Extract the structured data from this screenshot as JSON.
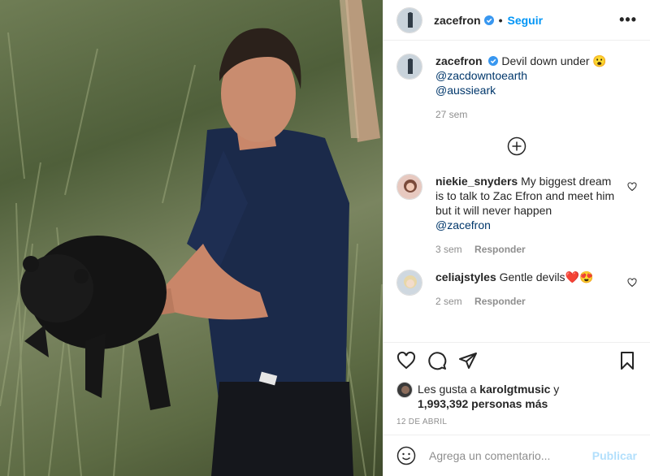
{
  "post": {
    "image_alt": "Man holding a Tasmanian devil in tall grass",
    "colors": {
      "accent": "#0095f6",
      "verified": "#3897f0",
      "muted": "#8e8e8e",
      "publish_disabled": "#b2dffc"
    }
  },
  "header": {
    "username": "zacefron",
    "separator": "•",
    "follow_label": "Seguir",
    "more_label": "•••"
  },
  "caption": {
    "username": "zacefron",
    "text": "Devil down under 😮",
    "mention1": "@zacdowntoearth",
    "mention2": "@aussieark",
    "time": "27 sem"
  },
  "comments": [
    {
      "username": "niekie_snyders",
      "text": "My biggest dream is to talk to Zac Efron and meet him but it will never happen",
      "mention": "@zacefron",
      "time": "3 sem",
      "reply_label": "Responder"
    },
    {
      "username": "celiajstyles",
      "text": "Gentle devils❤️😍",
      "time": "2 sem",
      "reply_label": "Responder"
    }
  ],
  "likes": {
    "prefix": "Les gusta a ",
    "user": "karolgtmusic",
    "suffix": " y",
    "count_text": "1,993,392 personas más"
  },
  "date": "12 DE ABRIL",
  "add_comment": {
    "placeholder": "Agrega un comentario...",
    "publish_label": "Publicar"
  }
}
